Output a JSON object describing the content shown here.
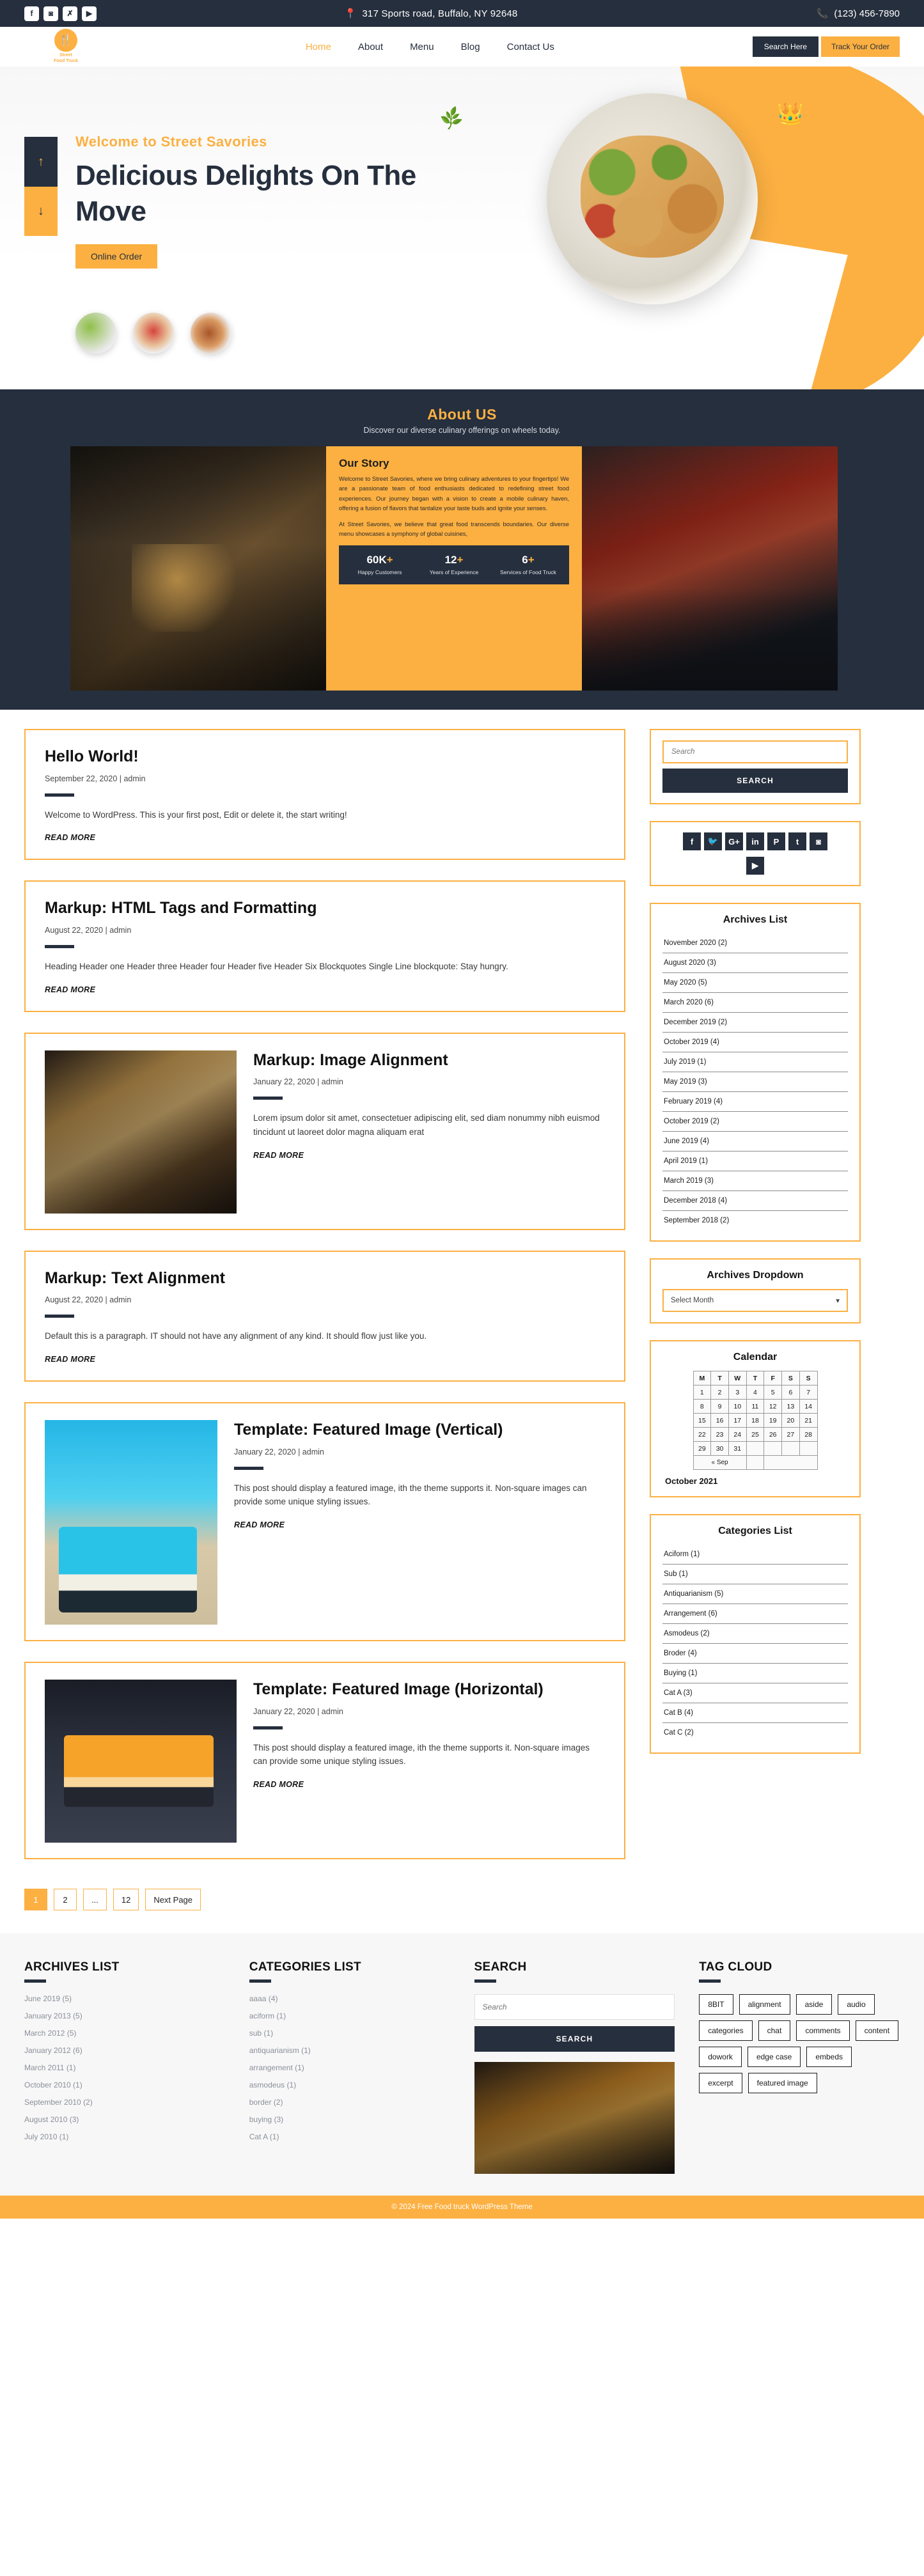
{
  "topbar": {
    "social": [
      {
        "name": "facebook-icon",
        "glyph": "f"
      },
      {
        "name": "instagram-icon",
        "glyph": "◙"
      },
      {
        "name": "x-twitter-icon",
        "glyph": "✗"
      },
      {
        "name": "youtube-icon",
        "glyph": "▶"
      }
    ],
    "address": "317 Sports road, Buffalo, NY 92648",
    "phone": "(123) 456-7890",
    "pin_icon": "location-pin-icon",
    "phone_icon": "phone-icon"
  },
  "nav": {
    "brand_line1": "Street",
    "brand_line2": "Food Truck",
    "links": [
      {
        "label": "Home",
        "active": true
      },
      {
        "label": "About",
        "active": false
      },
      {
        "label": "Menu",
        "active": false
      },
      {
        "label": "Blog",
        "active": false
      },
      {
        "label": "Contact Us",
        "active": false
      }
    ],
    "search_button": "Search Here",
    "track_button": "Track Your Order"
  },
  "hero": {
    "kicker": "Welcome to Street Savories",
    "title": "Delicious Delights On The Move",
    "cta": "Online Order",
    "scroll_up": "↑",
    "scroll_down": "↓",
    "slide_count": 4,
    "active_slide": 1
  },
  "about": {
    "title": "About US",
    "subtitle": "Discover our diverse culinary offerings on wheels today.",
    "card_title": "Our Story",
    "card_p1": "Welcome to Street Savories, where we bring culinary adventures to your fingertips! We are a passionate team of food enthusiasts dedicated to redefining street food experiences. Our journey began with a vision to create a mobile culinary haven, offering a fusion of flavors that tantalize your taste buds and ignite your senses.",
    "card_p2": "At Street Savories, we believe that great food transcends boundaries. Our diverse menu showcases a symphony of global cuisines,",
    "stats": [
      {
        "num": "60K",
        "plus": "+",
        "label": "Happy Customers"
      },
      {
        "num": "12",
        "plus": "+",
        "label": "Years of Experience"
      },
      {
        "num": "6",
        "plus": "+",
        "label": "Services of Food Truck"
      }
    ]
  },
  "posts": [
    {
      "title": "Hello World!",
      "meta": "September 22, 2020 | admin",
      "body": "Welcome to WordPress. This is your first post, Edit or delete it, the start writing!",
      "read_more": "READ MORE",
      "layout": "text",
      "image": ""
    },
    {
      "title": "Markup: HTML Tags and Formatting",
      "meta": "August 22, 2020 | admin",
      "body": "Heading Header one Header three Header four Header five Header Six Blockquotes Single Line blockquote: Stay hungry.",
      "read_more": "READ MORE",
      "layout": "text",
      "image": ""
    },
    {
      "title": "Markup: Image Alignment",
      "meta": "January 22, 2020 | admin",
      "body": "Lorem ipsum dolor sit amet, consectetuer adipiscing elit, sed diam nonummy nibh euismod tincidunt ut laoreet dolor magna aliquam erat",
      "read_more": "READ MORE",
      "layout": "image-left",
      "image": "bakery-display-photo"
    },
    {
      "title": "Markup: Text Alignment",
      "meta": "August 22, 2020 | admin",
      "body": "Default this is a paragraph. IT should not have any alignment of any kind. It should flow just like you.",
      "read_more": "READ MORE",
      "layout": "text",
      "image": ""
    },
    {
      "title": "Template: Featured Image (Vertical)",
      "meta": "January 22, 2020 | admin",
      "body": "This post should display a featured image, ith the theme supports it. Non-square images can provide some unique styling issues.",
      "read_more": "READ MORE",
      "layout": "image-left-vertical",
      "image": "blue-food-truck-photo"
    },
    {
      "title": "Template: Featured Image (Horizontal)",
      "meta": "January 22, 2020 | admin",
      "body": "This post should display a featured image, ith the theme supports it. Non-square images can provide some unique styling issues.",
      "read_more": "READ MORE",
      "layout": "image-left-horizontal",
      "image": "orange-food-truck-photo"
    }
  ],
  "pagination": [
    {
      "label": "1",
      "active": true
    },
    {
      "label": "2",
      "active": false
    },
    {
      "label": "...",
      "active": false
    },
    {
      "label": "12",
      "active": false
    },
    {
      "label": "Next Page",
      "active": false
    }
  ],
  "sidebar": {
    "search": {
      "placeholder": "Search",
      "value": "",
      "button": "SEARCH"
    },
    "social": [
      {
        "name": "facebook-icon",
        "glyph": "f"
      },
      {
        "name": "twitter-icon",
        "glyph": "🐦"
      },
      {
        "name": "google-plus-icon",
        "glyph": "G+"
      },
      {
        "name": "linkedin-icon",
        "glyph": "in"
      },
      {
        "name": "pinterest-icon",
        "glyph": "P"
      },
      {
        "name": "tumblr-icon",
        "glyph": "t"
      },
      {
        "name": "instagram-icon",
        "glyph": "◙"
      },
      {
        "name": "youtube-icon",
        "glyph": "▶"
      }
    ],
    "archives_title": "Archives List",
    "archives": [
      "November 2020 (2)",
      "August 2020 (3)",
      "May 2020 (5)",
      "March 2020 (6)",
      "December 2019 (2)",
      "October 2019 (4)",
      "July 2019 (1)",
      "May 2019 (3)",
      "February 2019 (4)",
      "October 2019 (2)",
      "June 2019 (4)",
      "April 2019 (1)",
      "March 2019 (3)",
      "December 2018 (4)",
      "September 2018 (2)"
    ],
    "dropdown_title": "Archives Dropdown",
    "dropdown_value": "Select Month",
    "calendar_title": "Calendar",
    "calendar": {
      "weekdays": [
        "M",
        "T",
        "W",
        "T",
        "F",
        "S",
        "S"
      ],
      "weeks": [
        [
          "1",
          "2",
          "3",
          "4",
          "5",
          "6",
          "7"
        ],
        [
          "8",
          "9",
          "10",
          "11",
          "12",
          "13",
          "14"
        ],
        [
          "15",
          "16",
          "17",
          "18",
          "19",
          "20",
          "21"
        ],
        [
          "22",
          "23",
          "24",
          "25",
          "26",
          "27",
          "28"
        ],
        [
          "29",
          "30",
          "31",
          "",
          "",
          "",
          ""
        ]
      ],
      "prev_label": "« Sep",
      "month_label": "October 2021"
    },
    "categories_title": "Categories List",
    "categories": [
      "Aciform (1)",
      "Sub (1)",
      "Antiquarianism (5)",
      "Arrangement (6)",
      "Asmodeus (2)",
      "Broder (4)",
      "Buying (1)",
      "Cat A (3)",
      "Cat B (4)",
      "Cat C (2)"
    ]
  },
  "footer": {
    "archives_title": "ARCHIVES LIST",
    "archives": [
      "June 2019 (5)",
      "January  2013 (5)",
      "March 2012 (5)",
      "January  2012 (6)",
      "March  2011 (1)",
      "October 2010 (1)",
      "September 2010 (2)",
      "August 2010 (3)",
      "July 2010 (1)"
    ],
    "categories_title": "CATEGORIES LIST",
    "categories": [
      "aaaa (4)",
      "aciform (1)",
      "sub (1)",
      "antiquarianism (1)",
      "arrangement (1)",
      "asmodeus (1)",
      "border (2)",
      "buying (3)",
      "Cat A (1)"
    ],
    "search_title": "SEARCH",
    "search_placeholder": "Search",
    "search_value": "",
    "search_button": "SEARCH",
    "tag_title": "TAG CLOUD",
    "tags": [
      "8BIT",
      "alignment",
      "aside",
      "audio",
      "categories",
      "chat",
      "comments",
      "content",
      "dowork",
      "edge case",
      "embeds",
      "excerpt",
      "featured image"
    ],
    "copyright": "© 2024  Free Food truck WordPress Theme"
  }
}
